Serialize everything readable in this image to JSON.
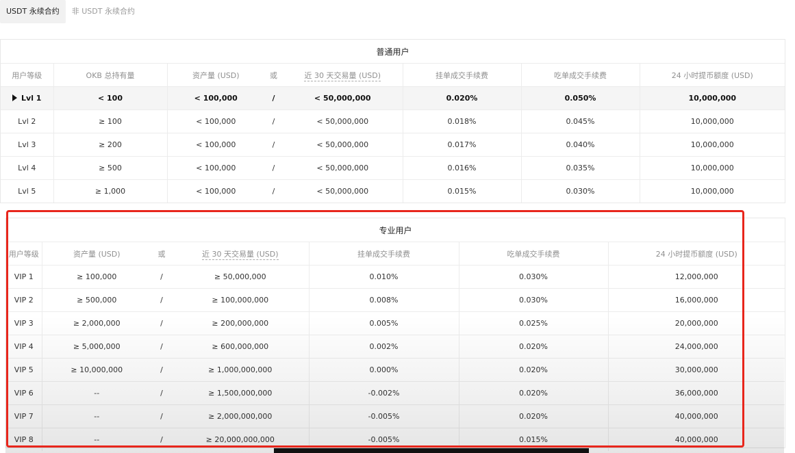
{
  "tabs": [
    {
      "label": "USDT 永续合约",
      "active": true
    },
    {
      "label": "非 USDT 永续合约",
      "active": false
    }
  ],
  "regular": {
    "title": "普通用户",
    "headers": [
      "用户等级",
      "OKB 总持有量",
      "资产量 (USD)",
      "或",
      "近 30 天交易量 (USD)",
      "挂单成交手续费",
      "吃单成交手续费",
      "24 小时提币额度 (USD)"
    ],
    "rows": [
      [
        "Lvl 1",
        "< 100",
        "< 100,000",
        "/",
        "< 50,000,000",
        "0.020%",
        "0.050%",
        "10,000,000"
      ],
      [
        "Lvl 2",
        "≥ 100",
        "< 100,000",
        "/",
        "< 50,000,000",
        "0.018%",
        "0.045%",
        "10,000,000"
      ],
      [
        "Lvl 3",
        "≥ 200",
        "< 100,000",
        "/",
        "< 50,000,000",
        "0.017%",
        "0.040%",
        "10,000,000"
      ],
      [
        "Lvl 4",
        "≥ 500",
        "< 100,000",
        "/",
        "< 50,000,000",
        "0.016%",
        "0.035%",
        "10,000,000"
      ],
      [
        "Lvl 5",
        "≥ 1,000",
        "< 100,000",
        "/",
        "< 50,000,000",
        "0.015%",
        "0.030%",
        "10,000,000"
      ]
    ],
    "current_level": "Lvl 1"
  },
  "pro": {
    "title": "专业用户",
    "headers": [
      "用户等级",
      "资产量 (USD)",
      "或",
      "近 30 天交易量 (USD)",
      "挂单成交手续费",
      "吃单成交手续费",
      "24 小时提币额度 (USD)"
    ],
    "rows": [
      [
        "VIP 1",
        "≥ 100,000",
        "/",
        "≥ 50,000,000",
        "0.010%",
        "0.030%",
        "12,000,000"
      ],
      [
        "VIP 2",
        "≥ 500,000",
        "/",
        "≥ 100,000,000",
        "0.008%",
        "0.030%",
        "16,000,000"
      ],
      [
        "VIP 3",
        "≥ 2,000,000",
        "/",
        "≥ 200,000,000",
        "0.005%",
        "0.025%",
        "20,000,000"
      ],
      [
        "VIP 4",
        "≥ 5,000,000",
        "/",
        "≥ 600,000,000",
        "0.002%",
        "0.020%",
        "24,000,000"
      ],
      [
        "VIP 5",
        "≥ 10,000,000",
        "/",
        "≥ 1,000,000,000",
        "0.000%",
        "0.020%",
        "30,000,000"
      ],
      [
        "VIP 6",
        "--",
        "/",
        "≥ 1,500,000,000",
        "-0.002%",
        "0.020%",
        "36,000,000"
      ],
      [
        "VIP 7",
        "--",
        "/",
        "≥ 2,000,000,000",
        "-0.005%",
        "0.020%",
        "40,000,000"
      ],
      [
        "VIP 8",
        "--",
        "/",
        "≥ 20,000,000,000",
        "-0.005%",
        "0.015%",
        "40,000,000"
      ]
    ]
  },
  "colors": {
    "highlight_border": "#e8261c",
    "current_row_bg": "#f5f5f5",
    "header_text": "#8f8f8f"
  },
  "icons": {
    "current_marker": "triangle-right-icon"
  }
}
